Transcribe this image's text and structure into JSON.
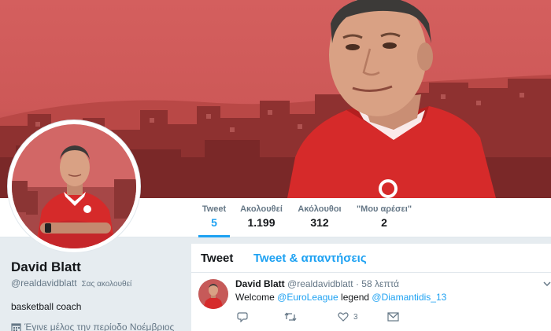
{
  "profile": {
    "name": "David Blatt",
    "handle": "@realdavidblatt",
    "follows_you": "Σας ακολουθεί",
    "bio": "basketball coach",
    "joined": "Έγινε μέλος την περίοδο Νοέμβριος"
  },
  "stats": [
    {
      "label": "Tweet",
      "value": "5"
    },
    {
      "label": "Ακολουθεί",
      "value": "1.199"
    },
    {
      "label": "Ακόλουθοι",
      "value": "312"
    },
    {
      "label": "\"Μου αρέσει\"",
      "value": "2"
    }
  ],
  "tabs": {
    "tweets": "Tweet",
    "tweets_replies": "Tweet & απαντήσεις"
  },
  "tweet": {
    "name": "David Blatt",
    "handle": "@realdavidblatt",
    "separator": "·",
    "time": "58 λεπτά",
    "text_prefix": "Welcome ",
    "mention1": "@EuroLeague",
    "text_middle": " legend ",
    "mention2": "@Diamantidis_13",
    "likes": "3"
  },
  "colors": {
    "accent": "#1da1f2",
    "banner_red": "#cf5b5a",
    "jersey_red": "#d62a2a",
    "page_bg": "#e6ecf0"
  },
  "icons": [
    "reply-icon",
    "retweet-icon",
    "like-icon",
    "message-icon",
    "calendar-icon",
    "chevron-down-icon"
  ]
}
